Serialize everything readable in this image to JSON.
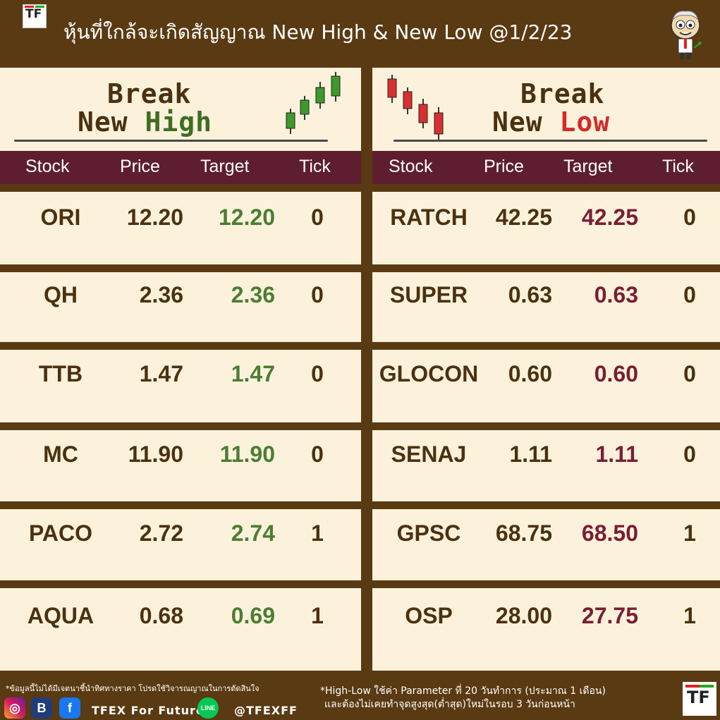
{
  "header": {
    "title": "หุ้นที่ใกล้จะเกิดสัญญาณ New High & New Low @1/2/23",
    "logo_text": "TF"
  },
  "high_panel": {
    "title_line1": "Break",
    "title_line2_a": "New ",
    "title_line2_b": "High",
    "columns": [
      "Stock",
      "Price",
      "Target",
      "Tick"
    ],
    "rows": [
      {
        "stock": "ORI",
        "price": "12.20",
        "target": "12.20",
        "tick": "0"
      },
      {
        "stock": "QH",
        "price": "2.36",
        "target": "2.36",
        "tick": "0"
      },
      {
        "stock": "TTB",
        "price": "1.47",
        "target": "1.47",
        "tick": "0"
      },
      {
        "stock": "MC",
        "price": "11.90",
        "target": "11.90",
        "tick": "0"
      },
      {
        "stock": "PACO",
        "price": "2.72",
        "target": "2.74",
        "tick": "1"
      },
      {
        "stock": "AQUA",
        "price": "0.68",
        "target": "0.69",
        "tick": "1"
      }
    ]
  },
  "low_panel": {
    "title_line1": "Break",
    "title_line2_a": "New ",
    "title_line2_b": "Low",
    "columns": [
      "Stock",
      "Price",
      "Target",
      "Tick"
    ],
    "rows": [
      {
        "stock": "RATCH",
        "price": "42.25",
        "target": "42.25",
        "tick": "0"
      },
      {
        "stock": "SUPER",
        "price": "0.63",
        "target": "0.63",
        "tick": "0"
      },
      {
        "stock": "GLOCON",
        "price": "0.60",
        "target": "0.60",
        "tick": "0"
      },
      {
        "stock": "SENAJ",
        "price": "1.11",
        "target": "1.11",
        "tick": "0"
      },
      {
        "stock": "GPSC",
        "price": "68.75",
        "target": "68.50",
        "tick": "1"
      },
      {
        "stock": "OSP",
        "price": "28.00",
        "target": "27.75",
        "tick": "1"
      }
    ]
  },
  "footer": {
    "disclaimer": "*ข้อมูลนี้ไม่ได้มีเจตนาชี้นำทิศทางราคา โปรดใช้วิจารณญาณในการตัดสินใจ",
    "social_icons": [
      "instagram-icon",
      "blockdit-icon",
      "facebook-icon",
      "line-icon"
    ],
    "social_glyphs": [
      "◎",
      "B",
      "f",
      "LINE"
    ],
    "brand_name": "TFEX For Future",
    "handle": "@TFEXFF",
    "note_line1": "*High-Low ใช้ค่า Parameter ที่ 20 วันทำการ (ประมาณ 1 เดือน)",
    "note_line2": "และต้องไม่เคยทำจุดสูงสุด(ต่ำสุด)ใหม่ในรอบ 3 วันก่อนหน้า",
    "logo_text": "TF"
  },
  "colors": {
    "background_brown": "#5a3a12",
    "panel_cream": "#fcf2dc",
    "header_bar_maroon": "#5e1e30",
    "target_green": "#4c7d32",
    "target_red": "#7a1d33",
    "low_accent_red": "#d32a2a"
  }
}
